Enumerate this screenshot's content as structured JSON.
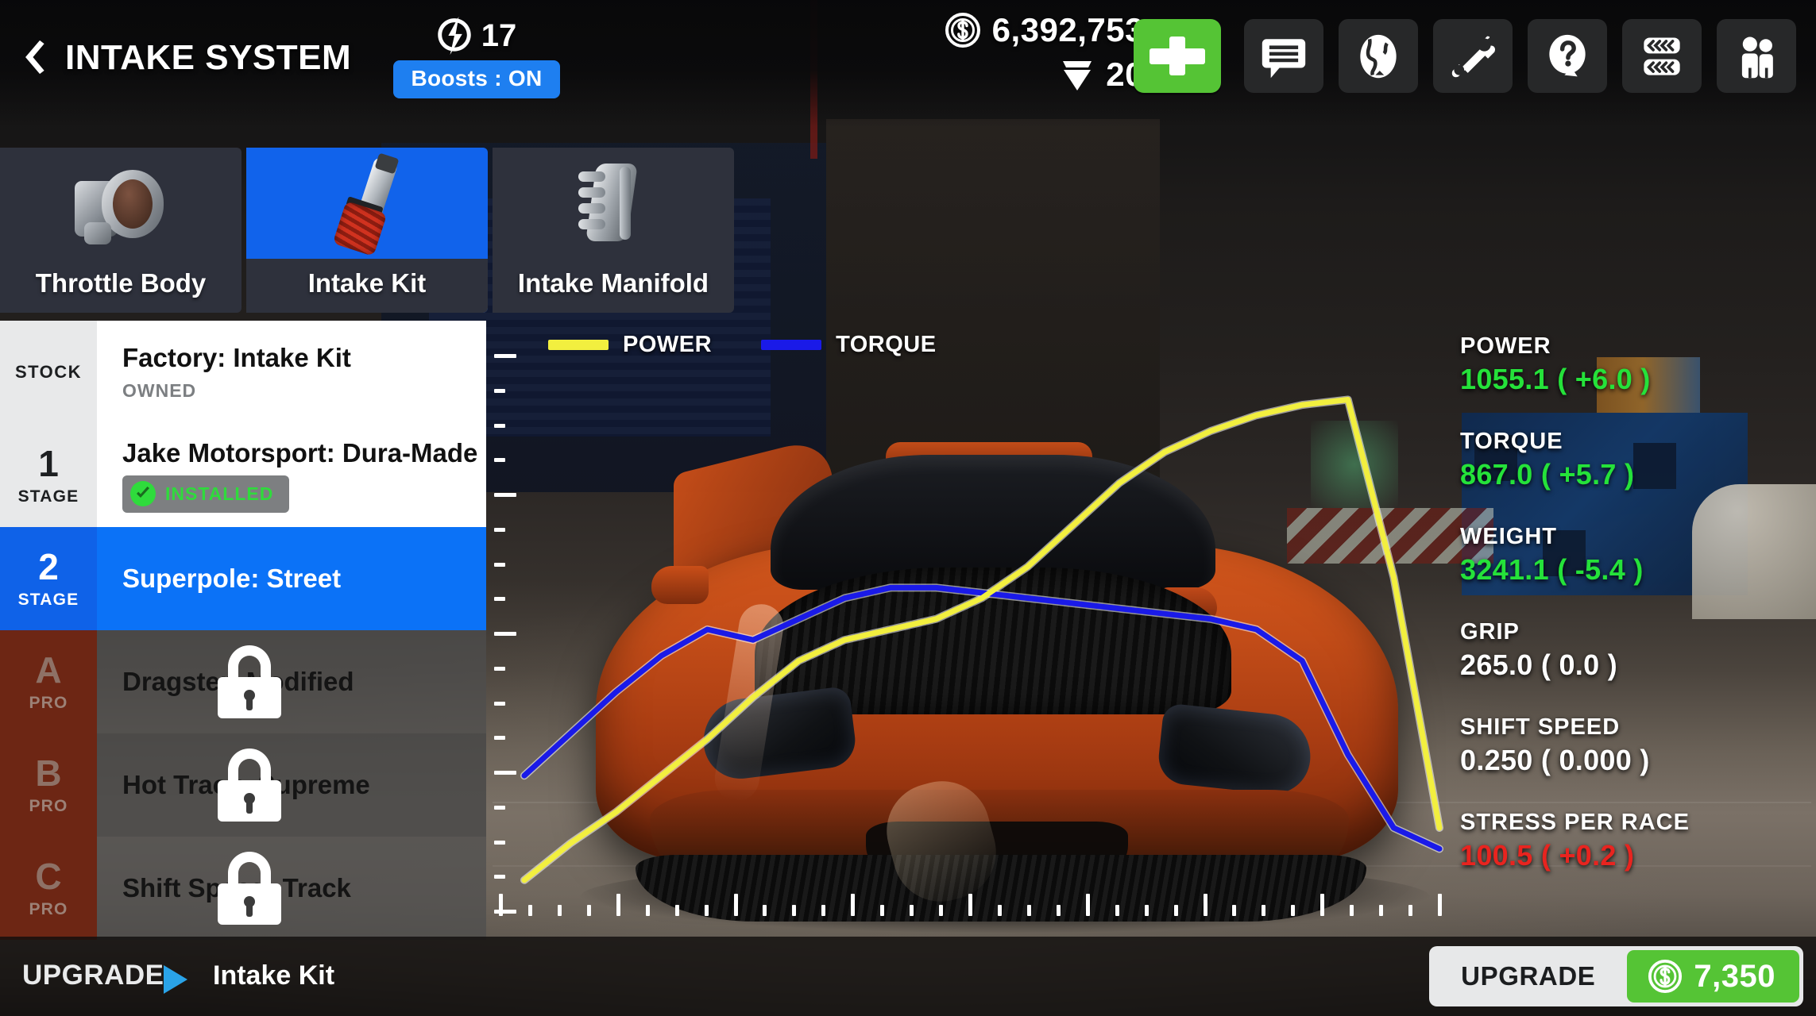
{
  "header": {
    "back_icon": "chevron-left-icon",
    "title": "INTAKE SYSTEM",
    "boost_icon": "boost-bolt-icon",
    "boost_count": "17",
    "boost_toggle_label": "Boosts : ON",
    "coin_icon": "coin-dollar-icon",
    "coins": "6,392,753",
    "gem_icon": "gem-icon",
    "gems": "20",
    "add_button_icon": "plus-icon",
    "icon_buttons": [
      {
        "name": "chat-icon"
      },
      {
        "name": "globe-icon"
      },
      {
        "name": "wrench-icon"
      },
      {
        "name": "question-icon"
      },
      {
        "name": "tires-icon"
      },
      {
        "name": "friends-icon"
      }
    ]
  },
  "tabs": [
    {
      "label": "Throttle Body",
      "art": "throttle-body",
      "active": false
    },
    {
      "label": "Intake Kit",
      "art": "intake-kit",
      "active": true
    },
    {
      "label": "Intake Manifold",
      "art": "intake-manifold",
      "active": false
    }
  ],
  "parts": [
    {
      "stage_num": "",
      "stage_cap": "STOCK",
      "title": "Factory: Intake Kit",
      "sub": "OWNED",
      "state": "stock",
      "locked": false,
      "installed": false
    },
    {
      "stage_num": "1",
      "stage_cap": "STAGE",
      "title": "Jake Motorsport: Dura-Made",
      "sub": "",
      "state": "owned",
      "locked": false,
      "installed": true,
      "installed_label": "INSTALLED"
    },
    {
      "stage_num": "2",
      "stage_cap": "STAGE",
      "title": "Superpole: Street",
      "sub": "",
      "state": "selected",
      "locked": false,
      "installed": false
    },
    {
      "stage_num": "A",
      "stage_cap": "PRO",
      "title": "Dragster: Modified",
      "sub": "",
      "state": "locked",
      "locked": true,
      "installed": false
    },
    {
      "stage_num": "B",
      "stage_cap": "PRO",
      "title": "Hot Track: Supreme",
      "sub": "",
      "state": "locked",
      "locked": true,
      "installed": false
    },
    {
      "stage_num": "C",
      "stage_cap": "PRO",
      "title": "Shift Speed: Track",
      "sub": "",
      "state": "locked",
      "locked": true,
      "installed": false
    }
  ],
  "stats": [
    {
      "name": "POWER",
      "value": "1055.1 ( +6.0 )",
      "tone": "up"
    },
    {
      "name": "TORQUE",
      "value": "867.0 ( +5.7 )",
      "tone": "up"
    },
    {
      "name": "WEIGHT",
      "value": "3241.1 ( -5.4 )",
      "tone": "up"
    },
    {
      "name": "GRIP",
      "value": "265.0 ( 0.0 )",
      "tone": "neutral"
    },
    {
      "name": "SHIFT SPEED",
      "value": "0.250 ( 0.000 )",
      "tone": "neutral"
    },
    {
      "name": "STRESS PER RACE",
      "value": "100.5 ( +0.2 )",
      "tone": "bad"
    }
  ],
  "bottom": {
    "breadcrumb_label": "UPGRADE",
    "breadcrumb_arrow_icon": "triangle-right-icon",
    "breadcrumb_current": "Intake Kit",
    "upgrade_label": "UPGRADE",
    "upgrade_coin_icon": "coin-dollar-icon",
    "upgrade_price": "7,350"
  },
  "colors": {
    "accent_blue": "#0b72f7",
    "green": "#55c435",
    "stat_up": "#25e23a",
    "stat_bad": "#e8241f",
    "locked_red": "#6d2614",
    "power_yellow": "#f2ef3f",
    "torque_blue": "#1a1ae8"
  },
  "chart_data": {
    "type": "line",
    "title": "",
    "xlabel": "",
    "ylabel": "",
    "grid": false,
    "legend_position": "top-left",
    "x": [
      0,
      5,
      10,
      15,
      20,
      25,
      30,
      35,
      40,
      45,
      50,
      55,
      60,
      65,
      70,
      75,
      80,
      85,
      90,
      95,
      100
    ],
    "xlim": [
      0,
      100
    ],
    "ylim": [
      0,
      100
    ],
    "series": [
      {
        "name": "POWER",
        "color": "#f2ef3f",
        "values": [
          2,
          9,
          15,
          22,
          29,
          37,
          44,
          48,
          50,
          52,
          56,
          62,
          70,
          78,
          84,
          88,
          91,
          93,
          94,
          60,
          12
        ]
      },
      {
        "name": "TORQUE",
        "color": "#1a1ae8",
        "values": [
          22,
          30,
          38,
          45,
          50,
          48,
          52,
          56,
          58,
          58,
          57,
          56,
          55,
          54,
          53,
          52,
          50,
          44,
          26,
          12,
          8
        ]
      }
    ],
    "y_ticks_major": [
      0,
      25,
      50,
      75,
      100
    ],
    "y_ticks_minor_per_major": 4,
    "x_ticks_major": [
      0,
      12.5,
      25,
      37.5,
      50,
      62.5,
      75,
      87.5,
      100
    ],
    "x_ticks_minor_per_major": 4
  }
}
